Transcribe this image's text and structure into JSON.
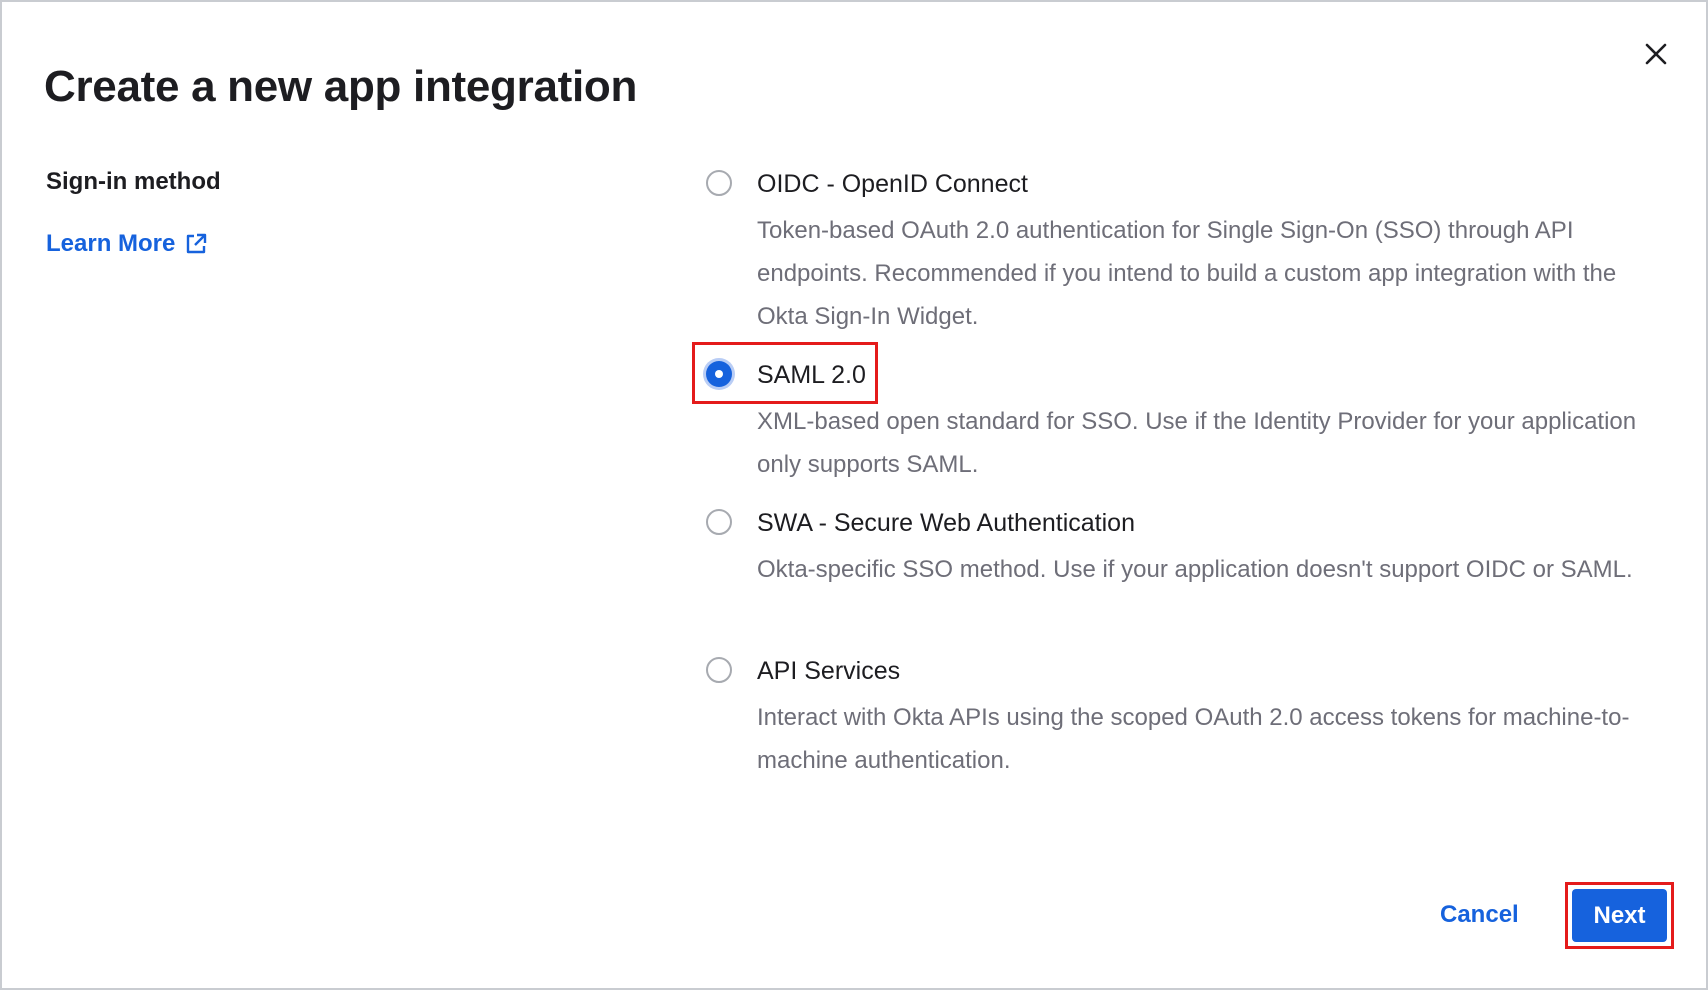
{
  "dialog": {
    "title": "Create a new app integration",
    "close_icon": "close-icon"
  },
  "sign_in": {
    "section_label": "Sign-in method",
    "learn_more_label": "Learn More",
    "learn_more_icon": "external-link-icon",
    "selected": "SAML 2.0",
    "options": [
      {
        "label": "OIDC - OpenID Connect",
        "description": "Token-based OAuth 2.0 authentication for Single Sign-On (SSO) through API endpoints. Recommended if you intend to build a custom app integration with the Okta Sign-In Widget.",
        "checked": false
      },
      {
        "label": "SAML 2.0",
        "description": "XML-based open standard for SSO. Use if the Identity Provider for your application only supports SAML.",
        "checked": true
      },
      {
        "label": "SWA - Secure Web Authentication",
        "description": "Okta-specific SSO method. Use if your application doesn't support OIDC or SAML.",
        "checked": false
      },
      {
        "label": "API Services",
        "description": "Interact with Okta APIs using the scoped OAuth 2.0 access tokens for machine-to-machine authentication.",
        "checked": false
      }
    ]
  },
  "footer": {
    "cancel_label": "Cancel",
    "next_label": "Next"
  },
  "colors": {
    "accent": "#1662dd",
    "highlight": "#e41b1b",
    "text_primary": "#1d1d21",
    "text_secondary": "#6e6e78"
  }
}
